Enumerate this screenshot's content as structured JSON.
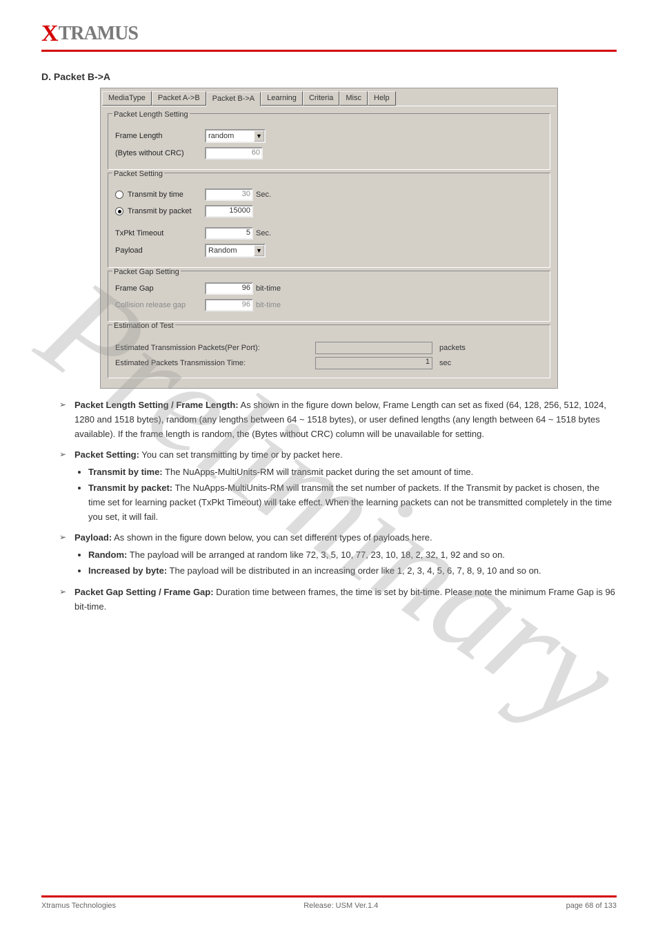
{
  "logo": {
    "x": "X",
    "rest": "TRAMUS"
  },
  "section_title": "D. Packet B->A",
  "watermark": "Preliminary",
  "tabs": [
    "MediaType",
    "Packet A->B",
    "Packet B->A",
    "Learning",
    "Criteria",
    "Misc",
    "Help"
  ],
  "packet_length": {
    "legend": "Packet Length Setting",
    "frame_length_label": "Frame Length",
    "frame_length_value": "random",
    "bytes_label": "(Bytes without CRC)",
    "bytes_value": "60"
  },
  "packet_setting": {
    "legend": "Packet Setting",
    "transmit_time_label": "Transmit by time",
    "transmit_time_value": "30",
    "transmit_time_unit": "Sec.",
    "transmit_packet_label": "Transmit by packet",
    "transmit_packet_value": "15000",
    "txpkt_timeout_label": "TxPkt Timeout",
    "txpkt_timeout_value": "5",
    "txpkt_timeout_unit": "Sec.",
    "payload_label": "Payload",
    "payload_value": "Random"
  },
  "packet_gap": {
    "legend": "Packet Gap Setting",
    "frame_gap_label": "Frame Gap",
    "frame_gap_value": "96",
    "frame_gap_unit": "bit-time",
    "collision_label": "Collision release gap",
    "collision_value": "96",
    "collision_unit": "bit-time"
  },
  "estimation": {
    "legend": "Estimation of Test",
    "packets_label": "Estimated Transmission Packets(Per Port):",
    "packets_value": "",
    "packets_unit": "packets",
    "time_label": "Estimated Packets Transmission Time:",
    "time_value": "1",
    "time_unit": "sec"
  },
  "bullets": {
    "b1_intro": "Packet Length Setting / Frame Length:",
    "b1_body": " As shown in the figure down below, Frame Length can set as fixed (64, 128, 256, 512, 1024, 1280 and 1518 bytes), random (any lengths between 64 ~ 1518 bytes), or user defined lengths (any length between 64 ~ 1518 bytes available). If the frame length is random, the (Bytes without CRC) column will be unavailable for setting.",
    "b2_intro": "Packet Setting:",
    "b2_body": " You can set transmitting by time or by packet here.",
    "b2_s1_intro": "Transmit by time:",
    "b2_s1_body": " The NuApps-MultiUnits-RM will transmit packet during the set amount of time.",
    "b2_s2_intro": "Transmit by packet:",
    "b2_s2_body": " The NuApps-MultiUnits-RM will transmit the set number of packets. If the Transmit by packet is chosen, the time set for learning packet (TxPkt Timeout) will take effect. When the learning packets can not be transmitted completely in the time you set, it will fail.",
    "b3_intro": "Payload:",
    "b3_body": " As shown in the figure down below, you can set different types of payloads here.",
    "b3_s1_intro": "Random:",
    "b3_s1_body": " The payload will be arranged at random like 72, 3, 5, 10, 77, 23, 10, 18, 2, 32, 1, 92 and so on.",
    "b3_s2_intro": "Increased by byte:",
    "b3_s2_body": " The payload will be distributed in an increasing order like 1, 2, 3, 4, 5, 6, 7, 8, 9, 10 and so on.",
    "b4_intro": "Packet Gap Setting / Frame Gap:",
    "b4_body": " Duration time between frames, the time is set by bit-time. Please note the minimum Frame Gap is 96 bit-time."
  },
  "footer": {
    "left": "Xtramus Technologies",
    "center": "Release: USM Ver.1.4",
    "right": "page 68 of 133"
  }
}
